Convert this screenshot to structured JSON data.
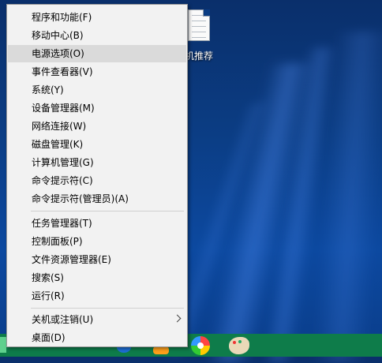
{
  "desktop": {
    "icon_label": "机推荐"
  },
  "menu": {
    "items": [
      {
        "label": "程序和功能(F)"
      },
      {
        "label": "移动中心(B)"
      },
      {
        "label": "电源选项(O)",
        "highlighted": true
      },
      {
        "label": "事件查看器(V)"
      },
      {
        "label": "系统(Y)"
      },
      {
        "label": "设备管理器(M)"
      },
      {
        "label": "网络连接(W)"
      },
      {
        "label": "磁盘管理(K)"
      },
      {
        "label": "计算机管理(G)"
      },
      {
        "label": "命令提示符(C)"
      },
      {
        "label": "命令提示符(管理员)(A)"
      },
      {
        "label": "任务管理器(T)"
      },
      {
        "label": "控制面板(P)"
      },
      {
        "label": "文件资源管理器(E)"
      },
      {
        "label": "搜索(S)"
      },
      {
        "label": "运行(R)"
      },
      {
        "label": "关机或注销(U)",
        "submenu": true
      },
      {
        "label": "桌面(D)"
      }
    ]
  },
  "colors": {
    "menu_bg": "#f2f2f2",
    "highlight": "#dadada",
    "taskbar": "#0e7c4a",
    "desktop": "#0b3c82"
  }
}
